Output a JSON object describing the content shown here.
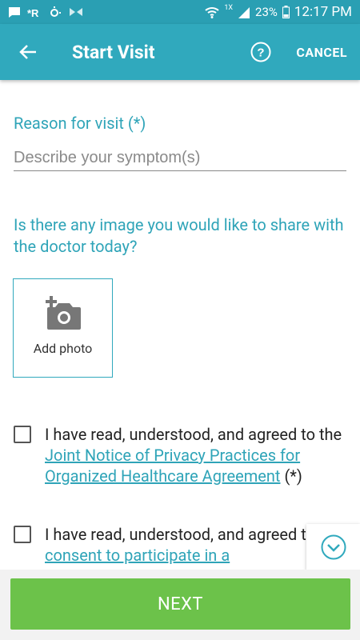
{
  "status_bar": {
    "battery": "23%",
    "time": "12:17 PM",
    "network": "1X"
  },
  "appbar": {
    "title": "Start Visit",
    "cancel_label": "CANCEL"
  },
  "form": {
    "reason_label": "Reason for visit (*)",
    "reason_placeholder": "Describe your symptom(s)",
    "reason_value": "",
    "image_question": "Is there any image you would like to share with the doctor today?",
    "add_photo_label": "Add photo"
  },
  "consents": [
    {
      "prefix": "I have read, understood, and agreed to the ",
      "link": "Joint Notice of Privacy Practices for Organized Healthcare Agreement",
      "suffix": " (*)",
      "checked": false
    },
    {
      "prefix": "I have read, understood, and agreed to the ",
      "link": "consent to participate in a",
      "suffix": "",
      "checked": false
    }
  ],
  "footer": {
    "next_label": "NEXT"
  },
  "colors": {
    "primary": "#30a9bd",
    "accent_green": "#6cc24a",
    "link": "#2fa4b8"
  },
  "icons": [
    "back-arrow-icon",
    "help-icon",
    "add-photo-camera-icon",
    "chevron-down-icon",
    "checkbox-icon"
  ]
}
